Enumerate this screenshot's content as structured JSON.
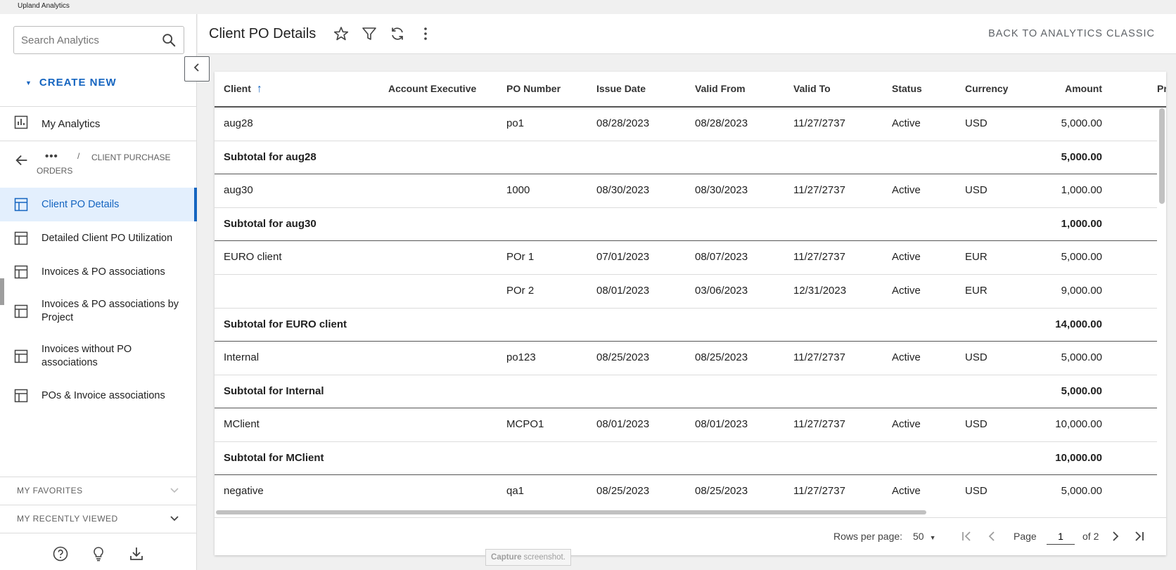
{
  "brand": "Upland Analytics",
  "sidebar": {
    "search_placeholder": "Search Analytics",
    "create_new": "CREATE NEW",
    "my_analytics": "My Analytics",
    "breadcrumb_ellipsis": "•••",
    "breadcrumb_sep": "/",
    "breadcrumb_current": "CLIENT PURCHASE ORDERS",
    "reports": [
      {
        "label": "Client PO Details"
      },
      {
        "label": "Detailed Client PO Utilization"
      },
      {
        "label": "Invoices & PO associations"
      },
      {
        "label": "Invoices & PO associations by Project"
      },
      {
        "label": "Invoices without PO associations"
      },
      {
        "label": "POs & Invoice associations"
      }
    ],
    "my_favorites": "MY FAVORITES",
    "my_recently_viewed": "MY RECENTLY VIEWED"
  },
  "header": {
    "title": "Client PO Details",
    "back_classic": "BACK TO ANALYTICS CLASSIC"
  },
  "table": {
    "columns": {
      "client": "Client",
      "account_executive": "Account Executive",
      "po_number": "PO Number",
      "issue_date": "Issue Date",
      "valid_from": "Valid From",
      "valid_to": "Valid To",
      "status": "Status",
      "currency": "Currency",
      "amount": "Amount",
      "truncated": "Pr"
    },
    "rows": [
      {
        "client": "aug28",
        "po": "po1",
        "issue": "08/28/2023",
        "from": "08/28/2023",
        "to": "11/27/2737",
        "status": "Active",
        "currency": "USD",
        "amount": "5,000.00"
      },
      {
        "subtotal": "Subtotal for aug28",
        "amount": "5,000.00"
      },
      {
        "client": "aug30",
        "po": "1000",
        "issue": "08/30/2023",
        "from": "08/30/2023",
        "to": "11/27/2737",
        "status": "Active",
        "currency": "USD",
        "amount": "1,000.00"
      },
      {
        "subtotal": "Subtotal for aug30",
        "amount": "1,000.00"
      },
      {
        "client": "EURO client",
        "po": "POr 1",
        "issue": "07/01/2023",
        "from": "08/07/2023",
        "to": "11/27/2737",
        "status": "Active",
        "currency": "EUR",
        "amount": "5,000.00"
      },
      {
        "client": "",
        "po": "POr 2",
        "issue": "08/01/2023",
        "from": "03/06/2023",
        "to": "12/31/2023",
        "status": "Active",
        "currency": "EUR",
        "amount": "9,000.00"
      },
      {
        "subtotal": "Subtotal for EURO client",
        "amount": "14,000.00"
      },
      {
        "client": "Internal",
        "po": "po123",
        "issue": "08/25/2023",
        "from": "08/25/2023",
        "to": "11/27/2737",
        "status": "Active",
        "currency": "USD",
        "amount": "5,000.00"
      },
      {
        "subtotal": "Subtotal for Internal",
        "amount": "5,000.00"
      },
      {
        "client": "MClient",
        "po": "MCPO1",
        "issue": "08/01/2023",
        "from": "08/01/2023",
        "to": "11/27/2737",
        "status": "Active",
        "currency": "USD",
        "amount": "10,000.00"
      },
      {
        "subtotal": "Subtotal for MClient",
        "amount": "10,000.00"
      },
      {
        "client": "negative",
        "po": "qa1",
        "issue": "08/25/2023",
        "from": "08/25/2023",
        "to": "11/27/2737",
        "status": "Active",
        "currency": "USD",
        "amount": "5,000.00"
      }
    ]
  },
  "pager": {
    "rows_per_page_label": "Rows per page:",
    "rows_per_page_value": "50",
    "page_label": "Page",
    "page_value": "1",
    "of_label": "of 2"
  },
  "capture_tip": {
    "bold": "Capture",
    "rest": "screenshot."
  },
  "colors": {
    "accent": "#1565c0",
    "active_bg": "#e3effd"
  }
}
